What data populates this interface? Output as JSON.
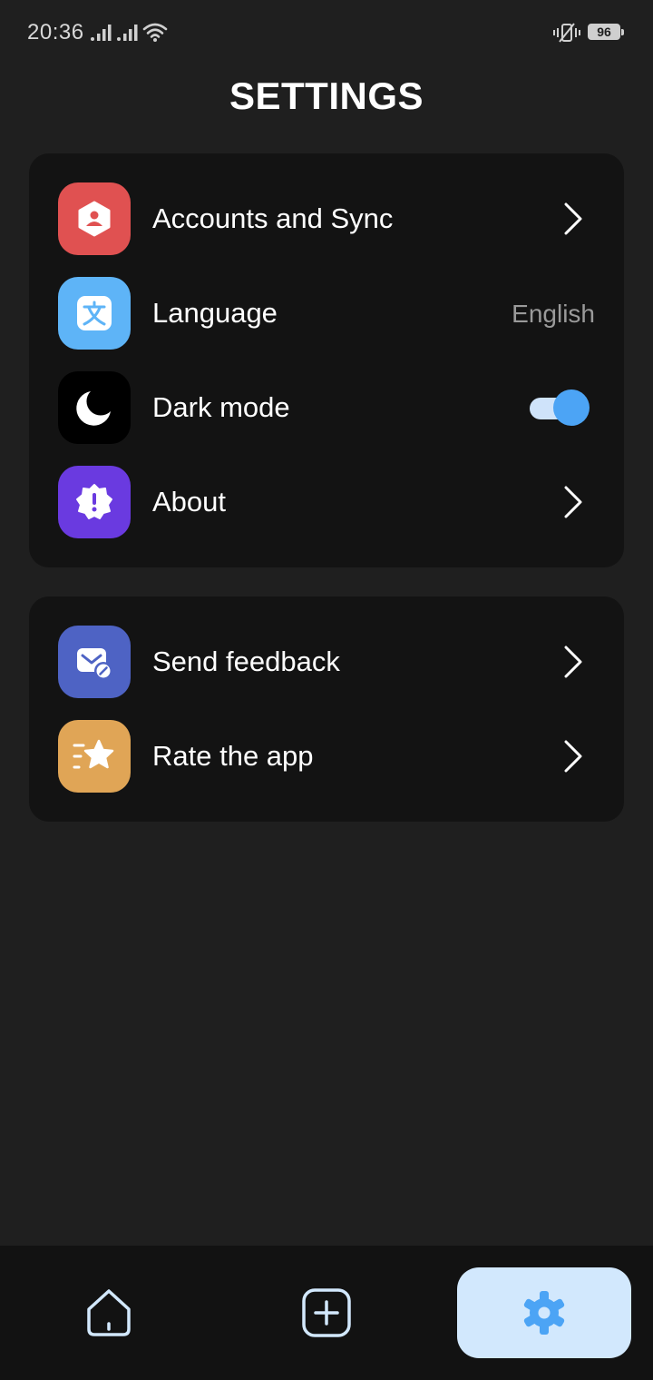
{
  "status_bar": {
    "time": "20:36",
    "battery_level": "96"
  },
  "page": {
    "title": "SETTINGS"
  },
  "settings_group_1": [
    {
      "label": "Accounts and Sync",
      "icon": "account-icon",
      "color": "#e05151"
    },
    {
      "label": "Language",
      "value": "English",
      "icon": "translate-icon",
      "color": "#5eb4f7"
    },
    {
      "label": "Dark mode",
      "icon": "moon-icon",
      "color": "#000000",
      "toggle_on": true
    },
    {
      "label": "About",
      "icon": "info-badge-icon",
      "color": "#6a3ae0"
    }
  ],
  "settings_group_2": [
    {
      "label": "Send feedback",
      "icon": "feedback-mail-icon",
      "color": "#4e63c4"
    },
    {
      "label": "Rate the app",
      "icon": "star-icon",
      "color": "#e0a556"
    }
  ],
  "bottom_nav": {
    "items": [
      "home-icon",
      "add-icon",
      "settings-gear-icon"
    ],
    "active": "settings-gear-icon",
    "active_color": "#4ca4f5",
    "active_bg": "#d2e8fd"
  }
}
